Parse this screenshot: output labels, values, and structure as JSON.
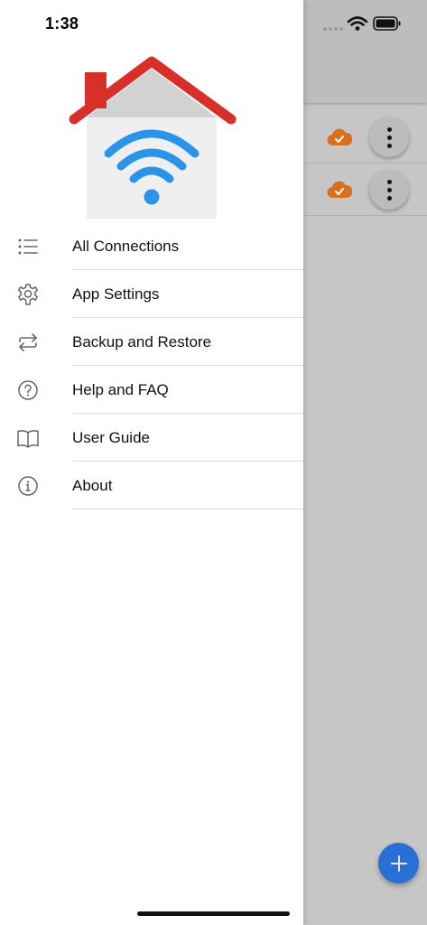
{
  "status_bar": {
    "time": "1:38"
  },
  "drawer": {
    "menu_items": [
      {
        "label": "All Connections",
        "icon": "list-icon"
      },
      {
        "label": "App Settings",
        "icon": "gear-icon"
      },
      {
        "label": "Backup and Restore",
        "icon": "sync-arrows-icon"
      },
      {
        "label": "Help and FAQ",
        "icon": "question-circle-icon"
      },
      {
        "label": "User Guide",
        "icon": "book-icon"
      },
      {
        "label": "About",
        "icon": "info-circle-icon"
      }
    ]
  },
  "colors": {
    "roof_red": "#d7302b",
    "wifi_blue": "#2a95e8",
    "cloud_orange": "#d96f1b",
    "fab_blue": "#2a6fd6",
    "overlay_gray": "#c6c6c6"
  }
}
